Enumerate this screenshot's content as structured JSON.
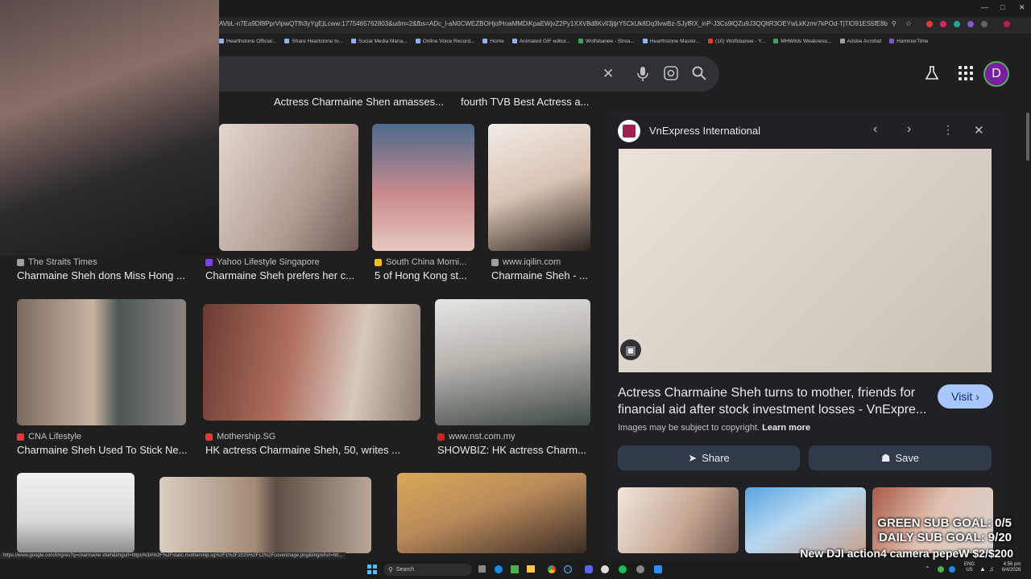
{
  "browser": {
    "url": "AVbL-n7Ea9Df8PprVlpwQTfh3yYgEjLcww:1775465762803&udm=2&fbs=ADc_l-aN0CWEZBOHjofHoaMMDiKpaEWjvZ2Py1XXV8d8KvlI3jtjrY5CkUk8Dq3lvwBz-SJyfRX_inP-J3Cs9lQZu9J3QQltR3OEYwLkKzmr7kPOd-TjTlO91ES5fE8bM4Q42vkNXa2TlbLTwoSQBpYYSrXli5beUA...",
    "bookmarks": [
      "Hearthstone Official...",
      "Share Heartstone to...",
      "Social Media Mana...",
      "Online Voice Record...",
      "Home",
      "Animated GIF editor...",
      "Wolfsbanee - Strea...",
      "Hearthstone Master...",
      "(10) Wolfsbanee - Y...",
      "MHWilds Weakness...",
      "Adobe Acrobat",
      "HammerTime"
    ],
    "status_url": "https://www.google.com/imgres?q=charmaine sheh&imgurl=https%3A%2F%2Fstatic.mothership.sg%2F1%2F2025%2F12%2Fcoverimage.png&imgrefurl=htt..."
  },
  "header": {
    "avatar_letter": "D",
    "icons": [
      "close-icon",
      "mic-icon",
      "lens-icon",
      "search-icon",
      "labs-icon",
      "apps-icon"
    ]
  },
  "grid": {
    "row0_captions": [
      "Actress Charmaine Shen amasses...",
      "fourth TVB Best Actress a..."
    ],
    "row1": [
      {
        "source": "The Straits Times",
        "caption": "Charmaine Sheh dons Miss Hong ...",
        "color": "#9aa0a6"
      },
      {
        "source": "Yahoo Lifestyle Singapore",
        "caption": "Charmaine Sheh prefers her c...",
        "color": "#7e3ff2"
      },
      {
        "source": "South China Morni...",
        "caption": "5 of Hong Kong st...",
        "color": "#f4c20d"
      },
      {
        "source": "www.iqilin.com",
        "caption": "Charmaine Sheh - ...",
        "color": "#9aa0a6"
      }
    ],
    "row2": [
      {
        "source": "CNA Lifestyle",
        "caption": "Charmaine Sheh Used To Stick Ne...",
        "color": "#e53935"
      },
      {
        "source": "Mothership.SG",
        "caption": "HK actress Charmaine Sheh, 50, writes ...",
        "color": "#e53935"
      },
      {
        "source": "www.nst.com.my",
        "caption": "SHOWBIZ: HK actress Charm...",
        "color": "#c62828"
      }
    ]
  },
  "panel": {
    "source": "VnExpress International",
    "title": "Actress Charmaine Sheh turns to mother, friends for financial aid after stock investment losses - VnExpre...",
    "visit_label": "Visit",
    "copyright_text": "Images may be subject to copyright.",
    "learn_more": "Learn more",
    "share_label": "Share",
    "save_label": "Save"
  },
  "overlay": {
    "green_goal": "GREEN SUB GOAL: 0/5",
    "daily_goal": "DAILY SUB GOAL: 9/20",
    "promo": "New DJI action4 camera pepeW $2/$200"
  },
  "taskbar": {
    "search_label": "Search",
    "lang": "ENG",
    "region": "US",
    "time": "4:56 pm",
    "date": "6/4/2026"
  }
}
